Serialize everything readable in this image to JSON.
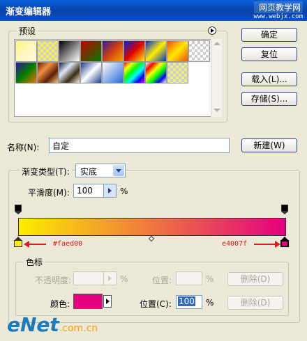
{
  "window": {
    "title": "渐变编辑器",
    "watermark_site": "网页教学网",
    "watermark_url": "www.webjx.com"
  },
  "presets": {
    "label": "预设",
    "menu_icon": "circle-arrow-right-icon"
  },
  "buttons": {
    "ok": "确定",
    "reset": "复位",
    "load": "载入(L)...",
    "save": "存储(S)...",
    "new": "新建(W)"
  },
  "name": {
    "label": "名称(N):",
    "value": "自定"
  },
  "gradient": {
    "type_label": "渐变类型(T):",
    "type_value": "实底",
    "smooth_label": "平滑度(M):",
    "smooth_value": "100",
    "smooth_unit": "%",
    "start_color": "#faed00",
    "end_color": "#e4007f",
    "start_hex_label": "#faed00",
    "end_hex_label": "e4007f"
  },
  "stops": {
    "label": "色标",
    "opacity_label": "不透明度:",
    "opacity_unit": "%",
    "opacity_location_label": "位置:",
    "opacity_location_unit": "%",
    "opacity_delete": "删除(D)",
    "color_label": "颜色:",
    "color_value": "#e4007f",
    "location_label": "位置(C):",
    "location_value": "100",
    "location_unit": "%",
    "color_delete": "删除(D)"
  },
  "watermark_bottom": {
    "logo": "eNet",
    "domain": ".com.cn"
  }
}
